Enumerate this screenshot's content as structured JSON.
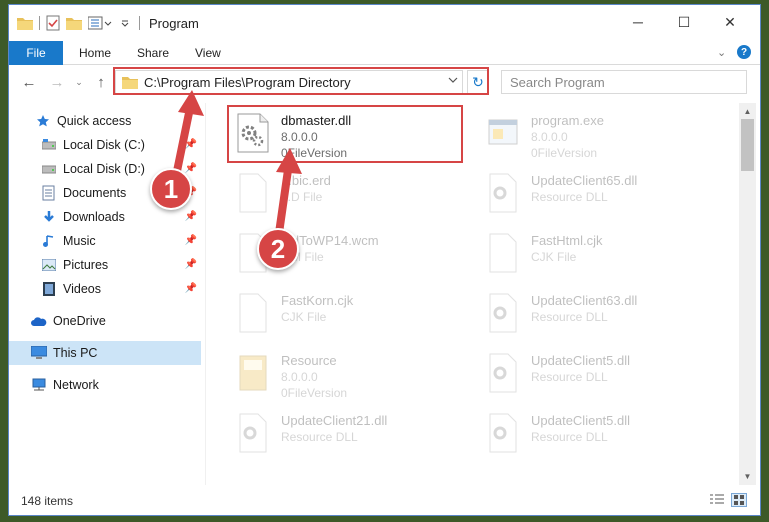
{
  "window": {
    "title": "Program",
    "controls": {
      "minimize": "─",
      "maximize": "☐",
      "close": "✕"
    }
  },
  "ribbon": {
    "tabs": [
      {
        "label": "File"
      },
      {
        "label": "Home"
      },
      {
        "label": "Share"
      },
      {
        "label": "View"
      }
    ]
  },
  "address_bar": {
    "path": "C:\\Program Files\\Program Directory",
    "search_placeholder": "Search Program"
  },
  "nav_pane": {
    "items": [
      {
        "label": "Quick access",
        "icon": "star-icon"
      },
      {
        "label": "Local Disk (C:)",
        "icon": "drive-icon",
        "pinned": true
      },
      {
        "label": "Local Disk (D:)",
        "icon": "drive-icon",
        "pinned": true
      },
      {
        "label": "Documents",
        "icon": "documents-icon",
        "pinned": true
      },
      {
        "label": "Downloads",
        "icon": "download-icon",
        "pinned": true
      },
      {
        "label": "Music",
        "icon": "music-icon",
        "pinned": true
      },
      {
        "label": "Pictures",
        "icon": "pictures-icon",
        "pinned": true
      },
      {
        "label": "Videos",
        "icon": "videos-icon",
        "pinned": true
      },
      {
        "label": "OneDrive",
        "icon": "cloud-icon"
      },
      {
        "label": "This PC",
        "icon": "computer-icon",
        "selected": true
      },
      {
        "label": "Network",
        "icon": "network-icon"
      }
    ]
  },
  "files": [
    {
      "name": "dbmaster.dll",
      "line2": "8.0.0.0",
      "line3": "0FileVersion",
      "highlighted": true
    },
    {
      "name": "program.exe",
      "line2": "8.0.0.0",
      "line3": "0FileVersion"
    },
    {
      "name": "...bic.erd",
      "line2": "...D File"
    },
    {
      "name": "UpdateClient65.dll",
      "line2": "Resource DLL"
    },
    {
      "name": "...dToWP14.wcm",
      "line2": "...M File"
    },
    {
      "name": "FastHtml.cjk",
      "line2": "CJK File"
    },
    {
      "name": "FastKorn.cjk",
      "line2": "CJK File"
    },
    {
      "name": "UpdateClient63.dll",
      "line2": "Resource DLL"
    },
    {
      "name": "Resource",
      "line2": "8.0.0.0",
      "line3": "0FileVersion"
    },
    {
      "name": "UpdateClient5.dll",
      "line2": "Resource DLL"
    },
    {
      "name": "UpdateClient21.dll",
      "line2": "Resource DLL"
    },
    {
      "name": "UpdateClient5.dll",
      "line2": "Resource DLL"
    }
  ],
  "status": {
    "item_count": "148 items"
  },
  "callouts": [
    "1",
    "2"
  ],
  "colors": {
    "accent": "#1979ca",
    "highlight": "#d64545",
    "selected_bg": "#cce4f7"
  }
}
